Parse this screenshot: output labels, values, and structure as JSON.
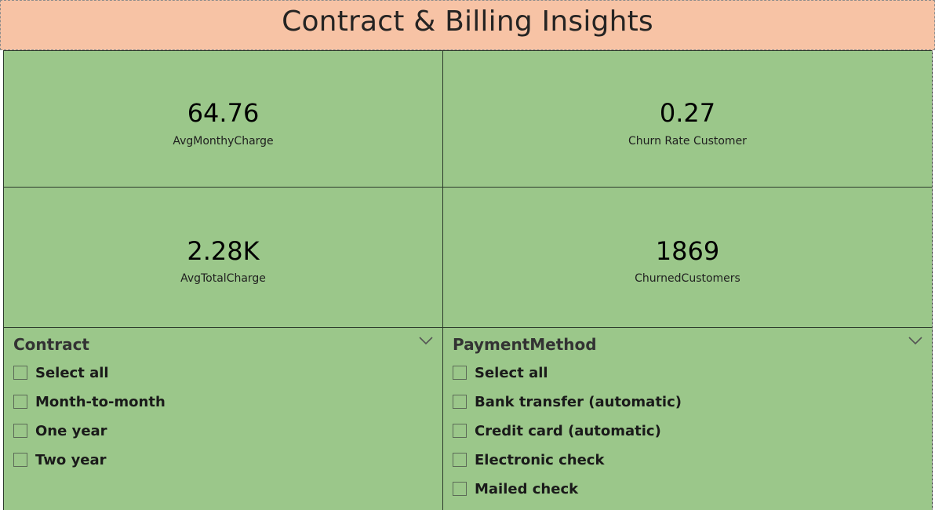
{
  "header": {
    "title": "Contract & Billing Insights"
  },
  "cards": {
    "avg_monthly": {
      "value": "64.76",
      "label": "AvgMonthyCharge"
    },
    "churn_rate": {
      "value": "0.27",
      "label": "Churn Rate Customer"
    },
    "avg_total": {
      "value": "2.28K",
      "label": "AvgTotalCharge"
    },
    "churned": {
      "value": "1869",
      "label": "ChurnedCustomers"
    }
  },
  "slicers": {
    "contract": {
      "title": "Contract",
      "options": [
        "Select all",
        "Month-to-month",
        "One year",
        "Two year"
      ]
    },
    "payment": {
      "title": "PaymentMethod",
      "options": [
        "Select all",
        "Bank transfer (automatic)",
        "Credit card (automatic)",
        "Electronic check",
        "Mailed check"
      ]
    }
  },
  "icons": {
    "dropdown": "chevron-down-icon",
    "checkbox": "checkbox-icon"
  },
  "colors": {
    "header_bg": "#f7c3a5",
    "panel_bg": "#9bc78a",
    "border": "#2b3a2b"
  }
}
